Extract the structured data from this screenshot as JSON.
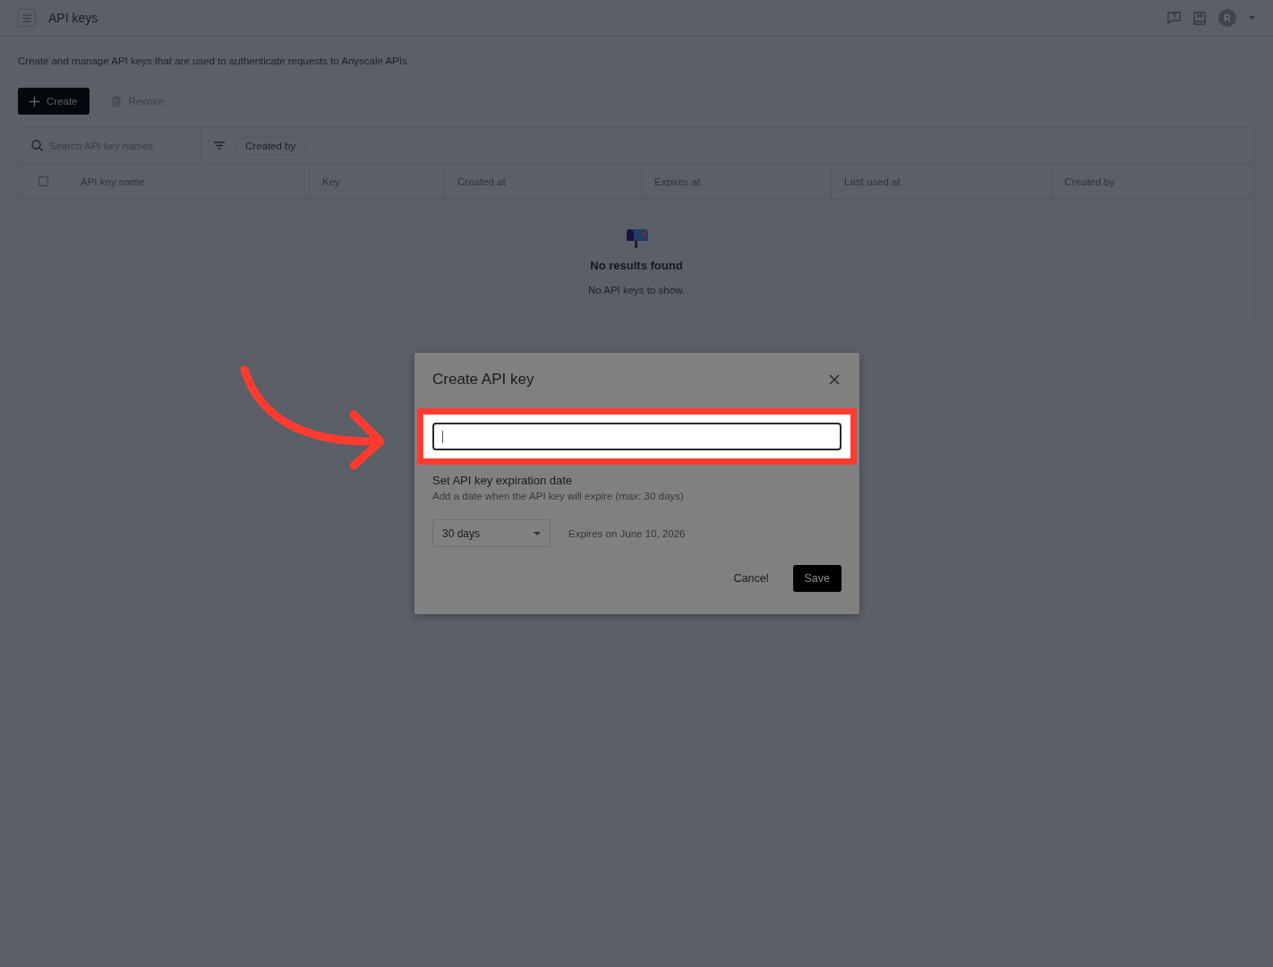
{
  "header": {
    "title": "API keys",
    "avatar_letter": "R"
  },
  "description": "Create and manage API keys that are used to authenticate requests to Anyscale APIs.",
  "actions": [
    {
      "label": "Create",
      "kind": "primary"
    },
    {
      "label": "Revoke",
      "kind": "secondary"
    }
  ],
  "toolbar": {
    "search": {
      "placeholder": "Search API key names"
    },
    "filter_chip": "Created by"
  },
  "table": {
    "select_all": {
      "checked": false
    },
    "columns": [
      "API key name",
      "Key",
      "Created at",
      "Expires at",
      "Last used at",
      "Created by"
    ],
    "empty_state": {
      "title": "No results found",
      "message": "No API keys to show."
    }
  },
  "dialog": {
    "title": "Create API key",
    "expiration": {
      "heading": "Set API key expiration date",
      "hint": "Add a date when the API key will expire (max: 30 days)",
      "select_value": "30 days",
      "expires_text": "Expires on June 10, 2026"
    },
    "buttons": [
      {
        "label": "Cancel",
        "kind": "text"
      },
      {
        "label": "Save",
        "kind": "primary"
      }
    ]
  },
  "annotation": {
    "highlight": true,
    "arrow": true
  }
}
